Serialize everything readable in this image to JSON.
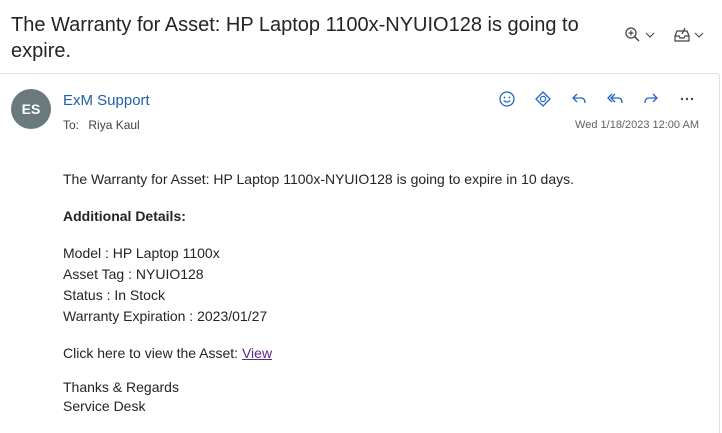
{
  "subject": "The Warranty for Asset: HP Laptop 1100x-NYUIO128 is going to expire.",
  "toolbar": {
    "zoom_icon": "zoom-in-icon",
    "inbox_icon": "tray-icon",
    "chevron": "chevron-down-icon"
  },
  "sender": {
    "initials": "ES",
    "name": "ExM Support",
    "to_label": "To:",
    "to": "Riya Kaul",
    "date": "Wed 1/18/2023 12:00 AM",
    "avatar_color": "#69797e",
    "name_color": "#1f5fa8"
  },
  "actions": [
    "smiley-icon",
    "loop-icon",
    "reply-icon",
    "reply-all-icon",
    "forward-icon",
    "more-icon"
  ],
  "body": {
    "intro": "The Warranty for Asset: HP Laptop 1100x-NYUIO128 is going to expire in 10 days.",
    "details_heading": "Additional Details:",
    "model": "Model :  HP Laptop 1100x",
    "asset_tag": "Asset Tag : NYUIO128",
    "status": "Status : In Stock",
    "warranty": "Warranty Expiration : 2023/01/27",
    "view_prompt": "Click here to view the Asset: ",
    "view_link": "View",
    "regards": "Thanks & Regards",
    "signature": "Service Desk"
  },
  "colors": {
    "accent": "#2266c4",
    "link": "#5b2a86"
  }
}
